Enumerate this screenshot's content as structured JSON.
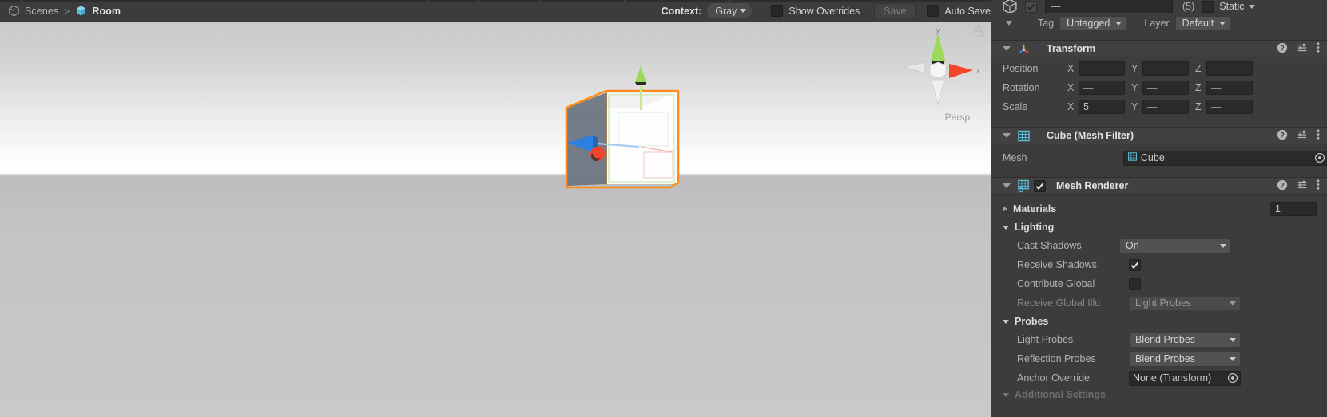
{
  "scene_view": {
    "breadcrumb": {
      "unity_icon": "unity-logo-icon",
      "scenes_label": "Scenes",
      "separator": ">",
      "scene_icon": "cube-icon",
      "scene_name": "Room"
    },
    "toolbar": {
      "context_label": "Context:",
      "context_value": "Gray",
      "show_overrides_label": "Show Overrides",
      "show_overrides_checked": false,
      "save_label": "Save",
      "save_enabled": false,
      "auto_save_label": "Auto Save",
      "auto_save_checked": false
    },
    "viewport": {
      "projection_label": "Persp",
      "gizmo_axes": [
        "y",
        "x"
      ],
      "selection_outline_color": "#ff8c1a",
      "axis_y_color": "#a2e05a",
      "axis_x_color": "#f2462c",
      "axis_z_color": "#2f7fe0",
      "sky_top_color": "#c9c9c9",
      "sky_bottom_color": "#ffffff",
      "ground_color": "#c3c3c3"
    }
  },
  "inspector": {
    "object_header": {
      "icon": "cube-icon",
      "enabled_checked": true,
      "name_value": "—",
      "multi_count": "(5)",
      "static_label": "Static",
      "static_checked": false
    },
    "tag_layer": {
      "tag_label": "Tag",
      "tag_value": "Untagged",
      "layer_label": "Layer",
      "layer_value": "Default"
    },
    "components": [
      {
        "title": "Transform",
        "icon": "transform-axis-icon",
        "expanded": true,
        "rows": [
          {
            "label": "Position",
            "x": "—",
            "y": "—",
            "z": "—"
          },
          {
            "label": "Rotation",
            "x": "—",
            "y": "—",
            "z": "—"
          },
          {
            "label": "Scale",
            "x": "5",
            "y": "—",
            "z": "—"
          }
        ]
      },
      {
        "title": "Cube (Mesh Filter)",
        "icon": "mesh-filter-icon",
        "expanded": true,
        "mesh_label": "Mesh",
        "mesh_value": "Cube"
      },
      {
        "title": "Mesh Renderer",
        "icon": "mesh-renderer-icon",
        "expanded": true,
        "enabled_checked": true,
        "materials_label": "Materials",
        "materials_count": "1",
        "lighting_label": "Lighting",
        "cast_shadows_label": "Cast Shadows",
        "cast_shadows_value": "On",
        "receive_shadows_label": "Receive Shadows",
        "receive_shadows_checked": true,
        "contribute_global_label": "Contribute Global",
        "contribute_global_checked": false,
        "receive_gi_label": "Receive Global Illu",
        "receive_gi_value": "Light Probes",
        "probes_label": "Probes",
        "light_probes_label": "Light Probes",
        "light_probes_value": "Blend Probes",
        "reflection_probes_label": "Reflection Probes",
        "reflection_probes_value": "Blend Probes",
        "anchor_override_label": "Anchor Override",
        "anchor_override_value": "None (Transform)",
        "additional_settings_label": "Additional Settings"
      }
    ],
    "axis_labels": {
      "x": "X",
      "y": "Y",
      "z": "Z"
    },
    "help_icon": "help-icon",
    "preset_icon": "preset-icon",
    "menu_icon": "more-menu-icon"
  },
  "colors": {
    "panel_bg": "#3c3c3c",
    "header_bg": "#414141",
    "field_bg": "#2a2a2a",
    "dropdown_bg": "#515151",
    "text": "#c9c9c9",
    "unity_cyan": "#4ec3e0"
  }
}
